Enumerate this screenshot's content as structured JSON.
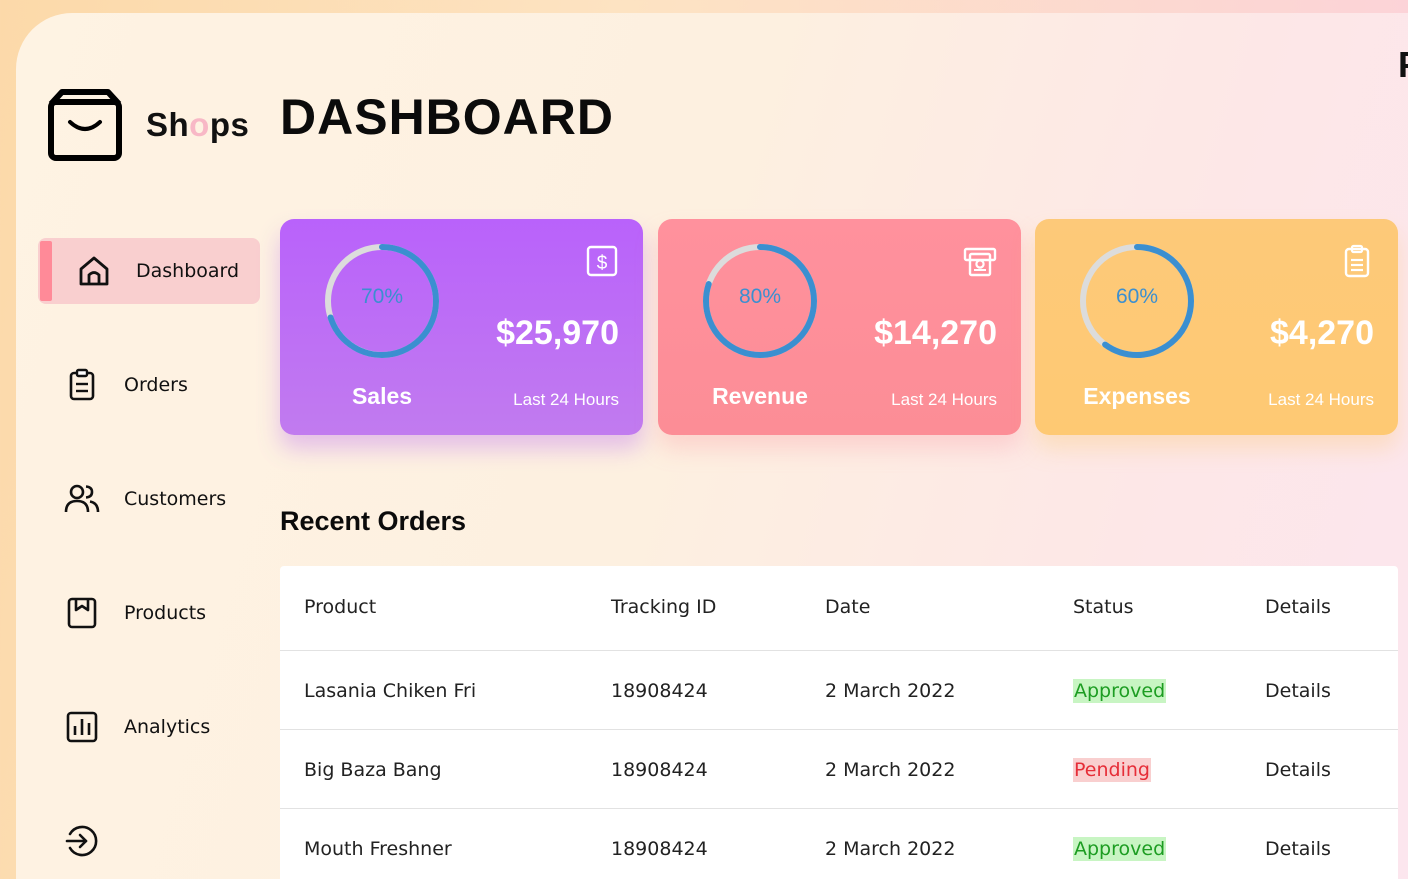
{
  "brand": {
    "name_start": "Sh",
    "name_o": "o",
    "name_end": "ps",
    "o_color": "#f8b8c6"
  },
  "corner_text": "F",
  "sidebar": {
    "items": [
      {
        "label": "Dashboard",
        "icon": "home-icon",
        "active": true
      },
      {
        "label": "Orders",
        "icon": "clipboard-icon",
        "active": false
      },
      {
        "label": "Customers",
        "icon": "users-icon",
        "active": false
      },
      {
        "label": "Products",
        "icon": "package-icon",
        "active": false
      },
      {
        "label": "Analytics",
        "icon": "bar-chart-icon",
        "active": false
      }
    ],
    "logout_icon": "sign-out-icon",
    "active_bg": "#f9cfcf",
    "active_indicator": "#ff8a98"
  },
  "header": {
    "title": "DASHBOARD"
  },
  "cards": [
    {
      "title": "Sales",
      "percent": 70,
      "percent_label": "70%",
      "value": "$25,970",
      "sub": "Last 24 Hours",
      "icon": "dollar-icon",
      "color": "#bb67ff"
    },
    {
      "title": "Revenue",
      "percent": 80,
      "percent_label": "80%",
      "value": "$14,270",
      "sub": "Last 24 Hours",
      "icon": "money-icon",
      "color": "#ff919d"
    },
    {
      "title": "Expenses",
      "percent": 60,
      "percent_label": "60%",
      "value": "$4,270",
      "sub": "Last 24 Hours",
      "icon": "clipboard-icon",
      "color": "#fdc977"
    }
  ],
  "ring_colors": {
    "progress": "#3b8fd0",
    "track": "#dcdcdc"
  },
  "recent_orders": {
    "title": "Recent Orders",
    "columns": [
      "Product",
      "Tracking ID",
      "Date",
      "Status",
      "Details"
    ],
    "rows": [
      {
        "product": "Lasania Chiken Fri",
        "tracking_id": "18908424",
        "date": "2 March 2022",
        "status": "Approved",
        "details": "Details"
      },
      {
        "product": "Big Baza Bang",
        "tracking_id": "18908424",
        "date": "2 March 2022",
        "status": "Pending",
        "details": "Details"
      },
      {
        "product": "Mouth Freshner",
        "tracking_id": "18908424",
        "date": "2 March 2022",
        "status": "Approved",
        "details": "Details"
      }
    ],
    "status_colors": {
      "Approved": "#1d9d22",
      "Pending": "#e62e38"
    }
  }
}
